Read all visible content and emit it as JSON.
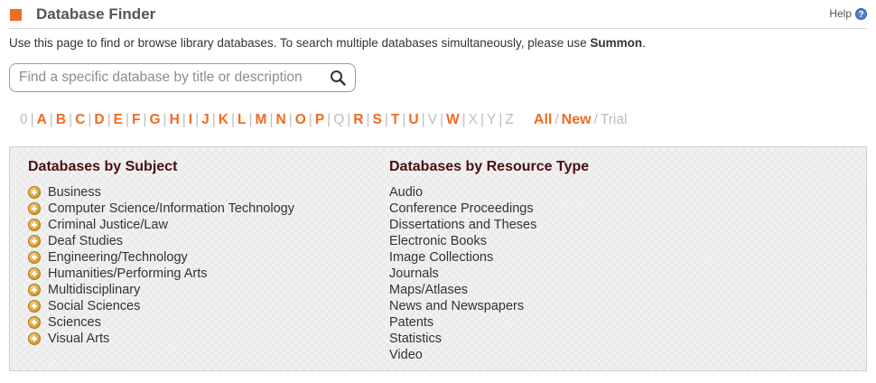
{
  "header": {
    "title": "Database Finder",
    "help_label": "Help",
    "accent": "#f26b21"
  },
  "intro": {
    "text": "Use this page to find or browse library databases. To search multiple databases simultaneously, please use ",
    "link": "Summon",
    "suffix": "."
  },
  "search": {
    "placeholder": "Find a specific database by title or description",
    "value": ""
  },
  "alphabet": {
    "items": [
      {
        "label": "0",
        "active": false
      },
      {
        "label": "A",
        "active": true
      },
      {
        "label": "B",
        "active": true
      },
      {
        "label": "C",
        "active": true
      },
      {
        "label": "D",
        "active": true
      },
      {
        "label": "E",
        "active": true
      },
      {
        "label": "F",
        "active": true
      },
      {
        "label": "G",
        "active": true
      },
      {
        "label": "H",
        "active": true
      },
      {
        "label": "I",
        "active": true
      },
      {
        "label": "J",
        "active": true
      },
      {
        "label": "K",
        "active": true
      },
      {
        "label": "L",
        "active": true
      },
      {
        "label": "M",
        "active": true
      },
      {
        "label": "N",
        "active": true
      },
      {
        "label": "O",
        "active": true
      },
      {
        "label": "P",
        "active": true
      },
      {
        "label": "Q",
        "active": false
      },
      {
        "label": "R",
        "active": true
      },
      {
        "label": "S",
        "active": true
      },
      {
        "label": "T",
        "active": true
      },
      {
        "label": "U",
        "active": true
      },
      {
        "label": "V",
        "active": false
      },
      {
        "label": "W",
        "active": true
      },
      {
        "label": "X",
        "active": false
      },
      {
        "label": "Y",
        "active": false
      },
      {
        "label": "Z",
        "active": false
      }
    ],
    "filters": [
      {
        "label": "All",
        "active": true
      },
      {
        "label": "New",
        "active": true
      },
      {
        "label": "Trial",
        "active": false
      }
    ]
  },
  "subjects": {
    "heading": "Databases by Subject",
    "items": [
      "Business",
      "Computer Science/Information Technology",
      "Criminal Justice/Law",
      "Deaf Studies",
      "Engineering/Technology",
      "Humanities/Performing Arts",
      "Multidisciplinary",
      "Social Sciences",
      "Sciences",
      "Visual Arts"
    ]
  },
  "resource_types": {
    "heading": "Databases by Resource Type",
    "items": [
      "Audio",
      "Conference Proceedings",
      "Dissertations and Theses",
      "Electronic Books",
      "Image Collections",
      "Journals",
      "Maps/Atlases",
      "News and Newspapers",
      "Patents",
      "Statistics",
      "Video"
    ]
  }
}
